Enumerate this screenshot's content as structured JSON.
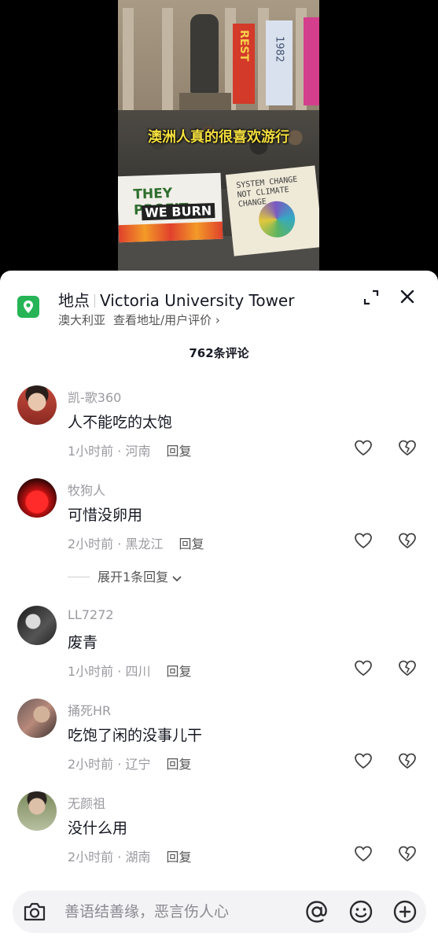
{
  "video": {
    "caption": "澳洲人真的很喜欢游行",
    "sign_left_line1": "THEY PROFIT",
    "sign_left_line2": "WE BURN",
    "sign_right_text": "SYSTEM CHANGE NOT CLIMATE CHANGE",
    "banner_red_text": "REST",
    "banner_blue_text": "1982"
  },
  "location": {
    "label": "地点",
    "name": "Victoria University Tower",
    "region": "澳大利亚",
    "link": "查看地址/用户评价",
    "link_chevron": "›",
    "icon": "location-pin-icon",
    "icon_color": "#26b456"
  },
  "comments_header": {
    "count_text": "762条评论"
  },
  "comments": [
    {
      "user": "凯-歌360",
      "text": "人不能吃的太饱",
      "time": "1小时前",
      "region": "河南",
      "reply": "回复"
    },
    {
      "user": "牧狗人",
      "text": "可惜没卵用",
      "time": "2小时前",
      "region": "黑龙江",
      "reply": "回复"
    },
    {
      "user": "LL7272",
      "text": "废青",
      "time": "1小时前",
      "region": "四川",
      "reply": "回复"
    },
    {
      "user": "捅死HR",
      "text": "吃饱了闲的没事儿干",
      "time": "2小时前",
      "region": "辽宁",
      "reply": "回复"
    },
    {
      "user": "无颜祖",
      "text": "没什么用",
      "time": "2小时前",
      "region": "湖南",
      "reply": "回复"
    }
  ],
  "meta_separator": " · ",
  "expand_replies": {
    "label": "展开1条回复"
  },
  "input_bar": {
    "placeholder": "善语结善缘，恶言伤人心"
  }
}
